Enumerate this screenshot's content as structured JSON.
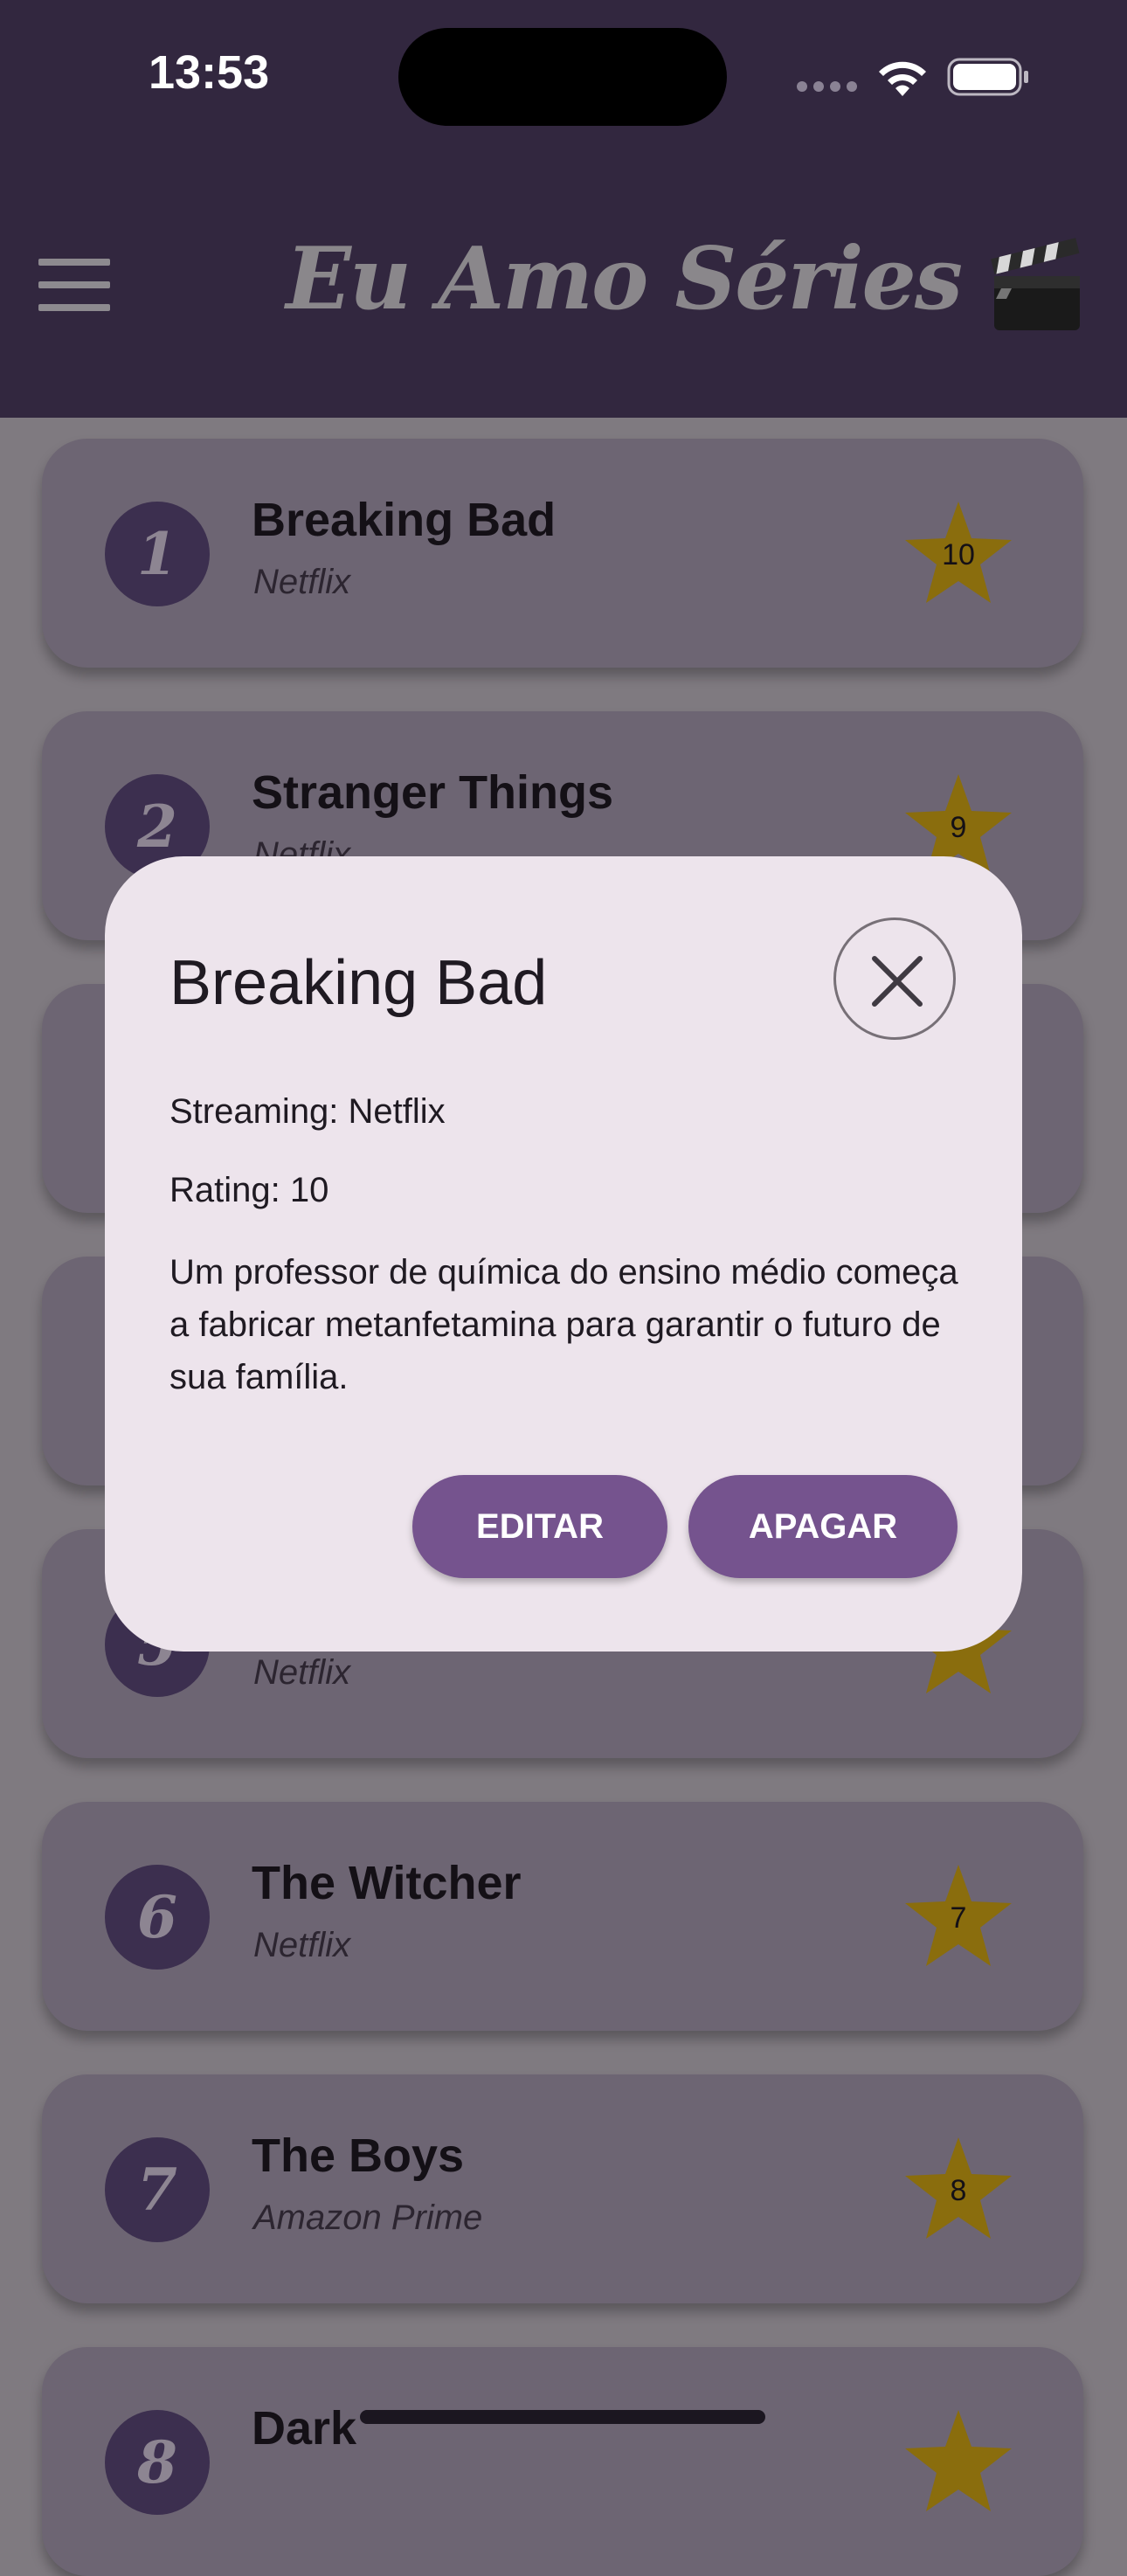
{
  "status_bar": {
    "time": "13:53"
  },
  "header": {
    "title": "Eu Amo Séries",
    "menu_icon": "hamburger-menu-icon",
    "title_icon": "clapperboard-icon"
  },
  "series": [
    {
      "rank": "1",
      "title": "Breaking Bad",
      "streaming": "Netflix",
      "rating": "10"
    },
    {
      "rank": "2",
      "title": "Stranger Things",
      "streaming": "Netflix",
      "rating": "9"
    },
    {
      "rank": "",
      "title": "",
      "streaming": "",
      "rating": ""
    },
    {
      "rank": "",
      "title": "",
      "streaming": "",
      "rating": ""
    },
    {
      "rank": "5",
      "title": "",
      "streaming": "Netflix",
      "rating": ""
    },
    {
      "rank": "6",
      "title": "The Witcher",
      "streaming": "Netflix",
      "rating": "7"
    },
    {
      "rank": "7",
      "title": "The Boys",
      "streaming": "Amazon Prime",
      "rating": "8"
    },
    {
      "rank": "8",
      "title": "Dark",
      "streaming": "",
      "rating": ""
    }
  ],
  "modal": {
    "title": "Breaking Bad",
    "streaming_line": "Streaming: Netflix",
    "rating_line": "Rating: 10",
    "description": "Um professor de química do ensino médio começa a fabricar metanfetamina para garantir o futuro de sua família.",
    "edit_label": "EDITAR",
    "delete_label": "APAGAR"
  },
  "colors": {
    "header_bg": "#32273f",
    "card_bg": "#6d6573",
    "badge_bg": "#3c2f4f",
    "star": "#8a6d0d",
    "modal_bg": "#ede4ec",
    "button": "#75538e"
  }
}
